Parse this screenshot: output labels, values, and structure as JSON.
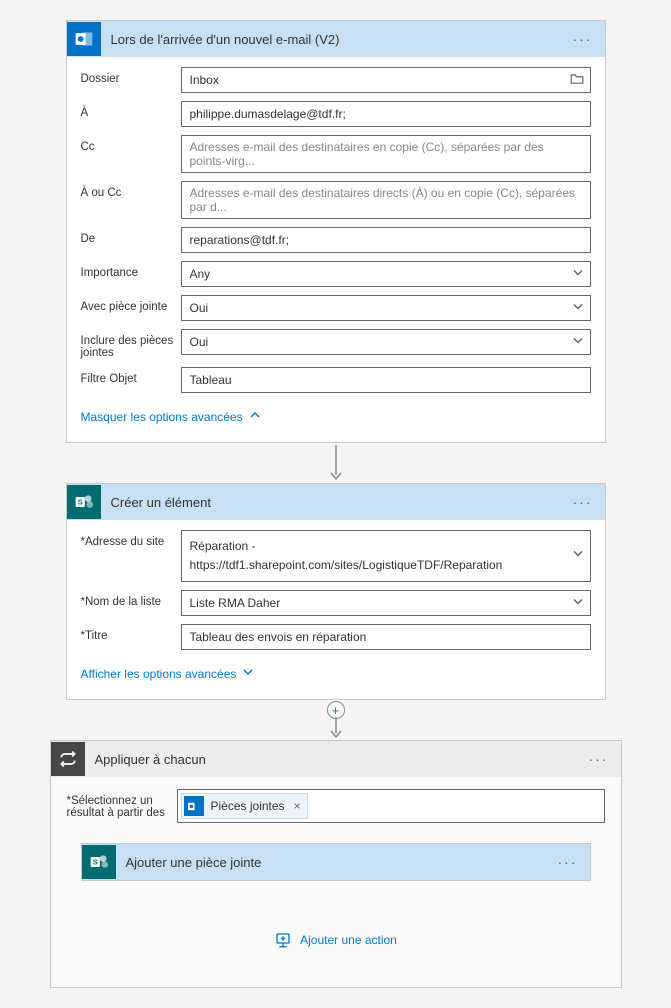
{
  "trigger": {
    "title": "Lors de l'arrivée d'un nouvel e-mail (V2)",
    "fields": {
      "folder_label": "Dossier",
      "folder_value": "Inbox",
      "to_label": "À",
      "to_value": "philippe.dumasdelage@tdf.fr;",
      "cc_label": "Cc",
      "cc_placeholder": "Adresses e-mail des destinataires en copie (Cc), séparées par des points-virg...",
      "tocc_label": "À ou Cc",
      "tocc_placeholder": "Adresses e-mail des destinataires directs (À) ou en copie (Cc), séparées par d...",
      "from_label": "De",
      "from_value": "reparations@tdf.fr;",
      "importance_label": "Importance",
      "importance_value": "Any",
      "hasatt_label": "Avec pièce jointe",
      "hasatt_value": "Oui",
      "includeatt_label": "Inclure des pièces jointes",
      "includeatt_value": "Oui",
      "subject_label": "Filtre Objet",
      "subject_value": "Tableau"
    },
    "toggle": "Masquer les options avancées"
  },
  "create": {
    "title": "Créer un élément",
    "fields": {
      "site_label": "Adresse du site",
      "site_value": "Réparation - https://tdf1.sharepoint.com/sites/LogistiqueTDF/Reparation",
      "list_label": "Nom de la liste",
      "list_value": "Liste RMA Daher",
      "titre_label": "Titre",
      "titre_value": "Tableau des envois en réparation"
    },
    "toggle": "Afficher les options avancées"
  },
  "apply": {
    "title": "Appliquer à chacun",
    "select_label": "Sélectionnez un résultat à partir des",
    "token": "Pièces jointes",
    "nested_title": "Ajouter une pièce jointe",
    "add_action": "Ajouter une action"
  }
}
